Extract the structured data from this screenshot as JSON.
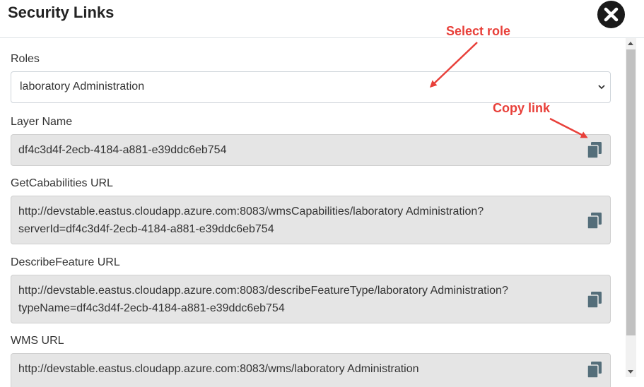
{
  "dialog": {
    "title": "Security Links"
  },
  "fields": {
    "roles": {
      "label": "Roles",
      "value": "laboratory Administration"
    },
    "layer_name": {
      "label": "Layer Name",
      "value": "df4c3d4f-2ecb-4184-a881-e39ddc6eb754"
    },
    "get_capabilities": {
      "label": "GetCababilities URL",
      "line1": "http://devstable.eastus.cloudapp.azure.com:8083/wmsCapabilities/laboratory Administration?",
      "line2": "serverId=df4c3d4f-2ecb-4184-a881-e39ddc6eb754"
    },
    "describe_feature": {
      "label": "DescribeFeature URL",
      "line1": "http://devstable.eastus.cloudapp.azure.com:8083/describeFeatureType/laboratory Administration?",
      "line2": "typeName=df4c3d4f-2ecb-4184-a881-e39ddc6eb754"
    },
    "wms": {
      "label": "WMS URL",
      "line1": "http://devstable.eastus.cloudapp.azure.com:8083/wms/laboratory Administration"
    }
  },
  "annotations": {
    "select_role": "Select role",
    "copy_link": "Copy link"
  },
  "icons": {
    "close": "close-icon",
    "copy": "copy-icon",
    "chevron": "chevron-down-icon"
  },
  "colors": {
    "annotation": "#e8403a",
    "readonly_bg": "#e5e5e5",
    "icon": "#546e7a"
  }
}
